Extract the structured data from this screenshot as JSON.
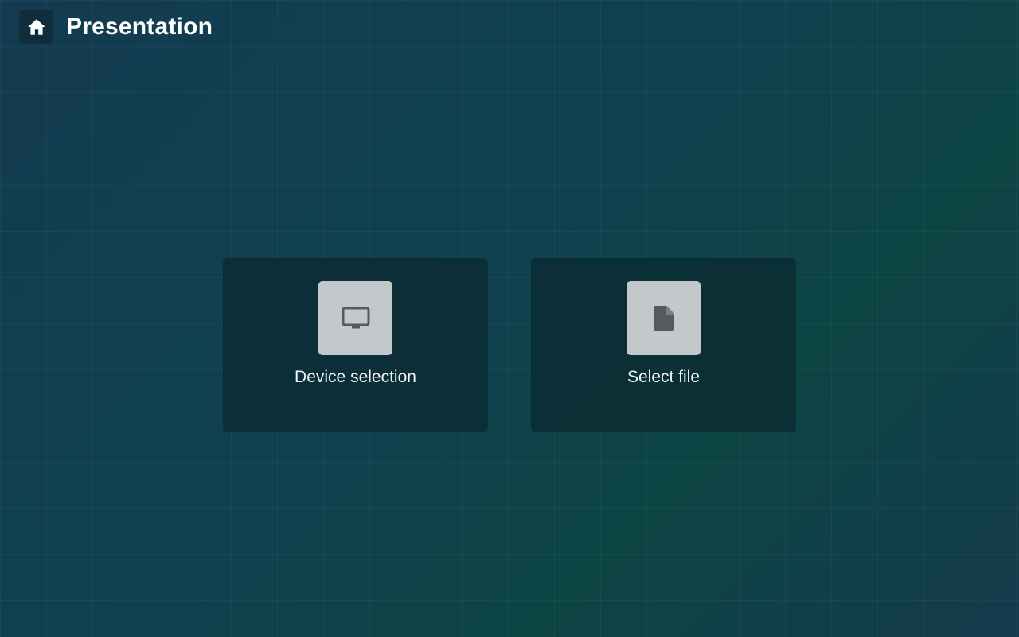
{
  "header": {
    "home_icon": "home-icon",
    "title": "Presentation"
  },
  "tiles": [
    {
      "icon": "monitor-icon",
      "label": "Device selection"
    },
    {
      "icon": "file-icon",
      "label": "Select file"
    }
  ],
  "colors": {
    "background_start": "#143b51",
    "background_end": "#0d4444",
    "tile_background": "#0a2a31",
    "icon_box": "#c3c9cb",
    "icon_glyph": "#555a5c",
    "text": "#ffffff"
  }
}
